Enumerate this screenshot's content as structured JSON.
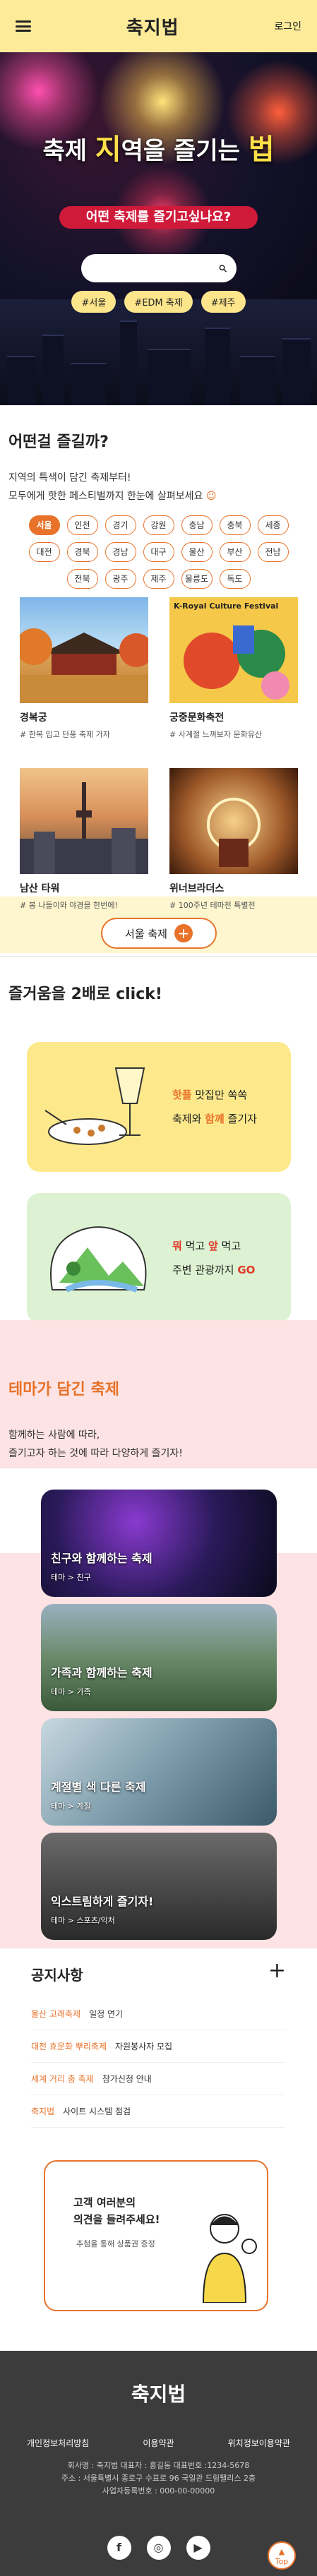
{
  "header": {
    "logo": "축지법",
    "login_label": "로그인"
  },
  "hero": {
    "title_pre": "축제",
    "title_mid1": "지",
    "title_mid2": "역을 즐기는",
    "title_end": "법",
    "subtitle": "어떤 축제를 즐기고싶나요?",
    "search_placeholder": "",
    "tags": [
      "#서울",
      "#EDM 축제",
      "#제주"
    ]
  },
  "festivals": {
    "title": "어떤걸 즐길까?",
    "desc_line1": "지역의 특색이 담긴 축제부터!",
    "desc_line2": "모두에게 핫한 페스티벌까지 한눈에 살펴보세요",
    "regions": [
      "서울",
      "인천",
      "경기",
      "강원",
      "충남",
      "충북",
      "세종",
      "대전",
      "경북",
      "경남",
      "대구",
      "울산",
      "부산",
      "전남",
      "전북",
      "광주",
      "제주",
      "울릉도",
      "독도"
    ],
    "active_region": "서울",
    "cards": [
      {
        "title": "경복궁",
        "desc": "# 한복 입고 단풍 축제 가자"
      },
      {
        "title": "궁중문화축전",
        "desc": "# 사계절 느껴보자 문화유산"
      },
      {
        "title": "남산 타워",
        "desc": "# 봉 나들이와 야경을 한번에!"
      },
      {
        "title": "위너브라더스",
        "desc": "# 100주년 테마전 특별전"
      }
    ],
    "card2_banner": "K-Royal Culture Festival",
    "more_label": "서울 축제"
  },
  "click": {
    "title": "즐거움을 2배로 click!",
    "promo1": {
      "hl1": "핫플",
      "rest1": " 맛집만 쏙쏙",
      "pre2": "축제와 ",
      "hl2": "함께",
      "rest2": " 즐기자"
    },
    "promo2": {
      "hl1": "뭐",
      "rest1": " 먹고 ",
      "hl1b": "앞",
      "rest1b": " 먹고",
      "pre2": "주변 관광까지 ",
      "hl2": "GO"
    }
  },
  "theme": {
    "title": "테마가 담긴 축제",
    "desc_line1": "함께하는 사람에 따라,",
    "desc_line2": "즐기고자 하는 것에 따라 다양하게 즐기자!",
    "cards": [
      {
        "label": "친구와 함께하는 축제",
        "sub": "테마 > 친구"
      },
      {
        "label": "가족과 함께하는 축제",
        "sub": "테마 > 가족"
      },
      {
        "label": "계절별 색 다른 축제",
        "sub": "테마 > 계절"
      },
      {
        "label": "익스트림하게 즐기자!",
        "sub": "테마 > 스포츠/익처"
      }
    ]
  },
  "notice": {
    "title": "공지사항",
    "items": [
      {
        "cat": "울산 고래축제",
        "txt": "일정 연기"
      },
      {
        "cat": "대전 효문화 뿌리축제",
        "txt": "자원봉사자 모집"
      },
      {
        "cat": "세계 거리 춤 축제",
        "txt": "참가신청 안내"
      },
      {
        "cat": "축지법",
        "txt": "사이트 시스템 점검"
      }
    ]
  },
  "feedback": {
    "title_line1": "고객 여러분의",
    "title_line2": "의견을 들려주세요!",
    "sub": "추첨을 통해 상품권 증정"
  },
  "footer": {
    "logo": "축지법",
    "links": [
      "개인정보처리방침",
      "이용약관",
      "위치정보이용약관"
    ],
    "info_line1": "회사명 : 축지법     대표자 : 홍길동     대표번호 :1234-5678",
    "info_line2": "주소 : 서울특별시 종로구 수표로 96 국일관 드림팰리스 2층",
    "info_line3": "사업자등록번호 : 000-00-00000",
    "social": [
      "f",
      "◎",
      "▶"
    ],
    "top_label": "Top"
  }
}
